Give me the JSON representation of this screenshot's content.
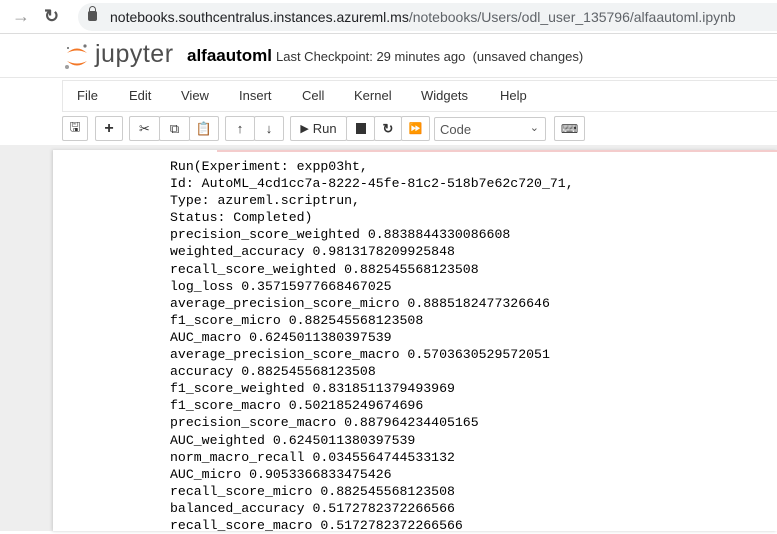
{
  "browser": {
    "url_host": "notebooks.southcentralus.instances.azureml.ms",
    "url_path": "/notebooks/Users/odl_user_135796/alfaautoml.ipynb"
  },
  "header": {
    "logo_text": "jupyter",
    "notebook_name": "alfaautoml",
    "checkpoint": "Last Checkpoint: 29 minutes ago",
    "unsaved": "(unsaved changes)"
  },
  "menu": [
    "File",
    "Edit",
    "View",
    "Insert",
    "Cell",
    "Kernel",
    "Widgets",
    "Help"
  ],
  "toolbar": {
    "run_label": "Run",
    "cell_type": "Code"
  },
  "output_lines": [
    "Run(Experiment: expp03ht,",
    "Id: AutoML_4cd1cc7a-8222-45fe-81c2-518b7e62c720_71,",
    "Type: azureml.scriptrun,",
    "Status: Completed)",
    "precision_score_weighted 0.8838844330086608",
    "weighted_accuracy 0.9813178209925848",
    "recall_score_weighted 0.882545568123508",
    "log_loss 0.35715977668467025",
    "average_precision_score_micro 0.8885182477326646",
    "f1_score_micro 0.882545568123508",
    "AUC_macro 0.6245011380397539",
    "average_precision_score_macro 0.5703630529572051",
    "accuracy 0.882545568123508",
    "f1_score_weighted 0.8318511379493969",
    "f1_score_macro 0.502185249674696",
    "precision_score_macro 0.887964234405165",
    "AUC_weighted 0.6245011380397539",
    "norm_macro_recall 0.0345564744533132",
    "AUC_micro 0.9053366833475426",
    "recall_score_micro 0.882545568123508",
    "balanced_accuracy 0.5172782372266566",
    "recall_score_macro 0.5172782372266566"
  ]
}
